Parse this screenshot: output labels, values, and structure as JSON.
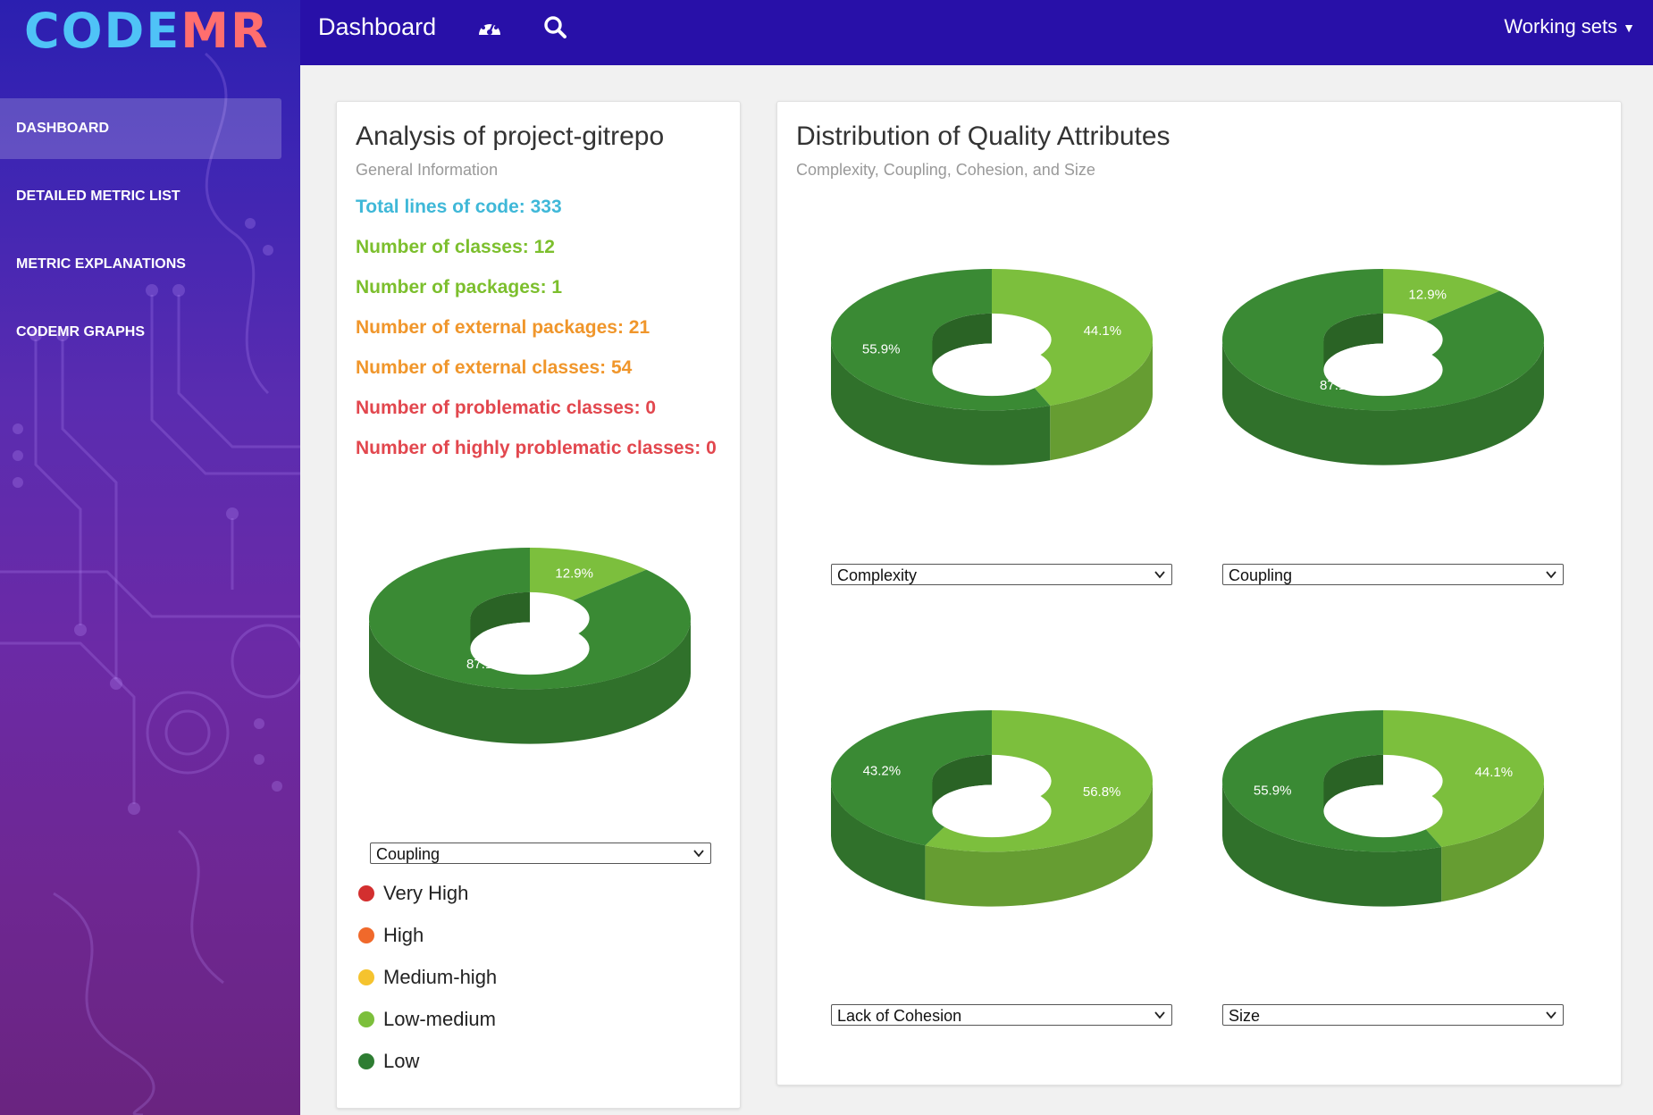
{
  "logo": {
    "part1": "CODE",
    "part2": "MR"
  },
  "sidebar": {
    "items": [
      {
        "label": "DASHBOARD",
        "active": true
      },
      {
        "label": "DETAILED METRIC LIST"
      },
      {
        "label": "METRIC EXPLANATIONS"
      },
      {
        "label": "CODEMR GRAPHS"
      }
    ]
  },
  "topbar": {
    "title": "Dashboard",
    "working_sets": "Working sets"
  },
  "analysis": {
    "title": "Analysis of project-gitrepo",
    "subtitle": "General Information",
    "stats": [
      {
        "text": "Total lines of code: 333",
        "color": "#3fb8d8"
      },
      {
        "text": "Number of classes: 12",
        "color": "#7cbf2d"
      },
      {
        "text": "Number of packages: 1",
        "color": "#7cbf2d"
      },
      {
        "text": "Number of external packages: 21",
        "color": "#f0962b"
      },
      {
        "text": "Number of external classes: 54",
        "color": "#f0962b"
      },
      {
        "text": "Number of problematic classes: 0",
        "color": "#e2474e"
      },
      {
        "text": "Number of highly problematic classes: 0",
        "color": "#e2474e"
      }
    ],
    "select": "Coupling",
    "legend": [
      {
        "label": "Very High",
        "color": "#d32f2f"
      },
      {
        "label": "High",
        "color": "#f0692b"
      },
      {
        "label": "Medium-high",
        "color": "#f5c32e"
      },
      {
        "label": "Low-medium",
        "color": "#7cbf3b"
      },
      {
        "label": "Low",
        "color": "#2e7d32"
      }
    ]
  },
  "distribution": {
    "title": "Distribution of Quality Attributes",
    "subtitle": "Complexity, Coupling, Cohesion, and Size"
  },
  "colors": {
    "low": "#3a8a34",
    "low_medium": "#7cbf3d"
  },
  "chart_data": [
    {
      "type": "pie",
      "name": "Coupling",
      "categories": [
        "Low-medium",
        "Low"
      ],
      "values": [
        12.9,
        87.1
      ],
      "labels": [
        "12.9%",
        "87.1%"
      ]
    },
    {
      "type": "pie",
      "name": "Complexity",
      "categories": [
        "Low-medium",
        "Low"
      ],
      "values": [
        44.1,
        55.9
      ],
      "labels": [
        "44.1%",
        "55.9%"
      ]
    },
    {
      "type": "pie",
      "name": "Coupling",
      "categories": [
        "Low-medium",
        "Low"
      ],
      "values": [
        12.9,
        87.1
      ],
      "labels": [
        "12.9%",
        "87.1%"
      ]
    },
    {
      "type": "pie",
      "name": "Lack of Cohesion",
      "categories": [
        "Low-medium",
        "Low"
      ],
      "values": [
        56.8,
        43.2
      ],
      "labels": [
        "56.8%",
        "43.2%"
      ]
    },
    {
      "type": "pie",
      "name": "Size",
      "categories": [
        "Low-medium",
        "Low"
      ],
      "values": [
        44.1,
        55.9
      ],
      "labels": [
        "44.1%",
        "55.9%"
      ]
    }
  ]
}
